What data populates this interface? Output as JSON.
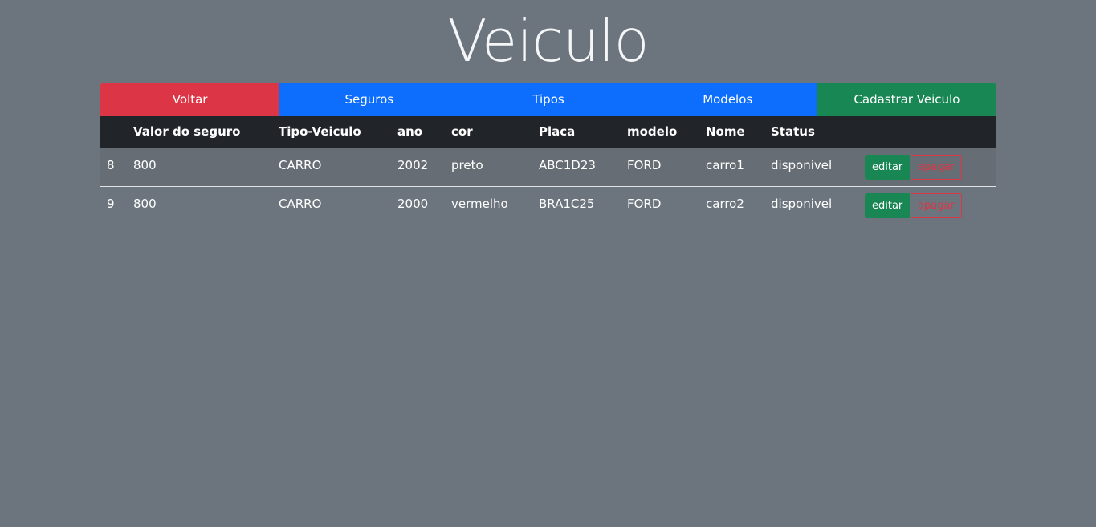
{
  "page": {
    "title": "Veiculo"
  },
  "nav": {
    "voltar": "Voltar",
    "seguros": "Seguros",
    "tipos": "Tipos",
    "modelos": "Modelos",
    "cadastrar": "Cadastrar Veiculo"
  },
  "colors": {
    "background": "#6c757d",
    "danger": "#dc3545",
    "primary": "#0d6efd",
    "success": "#198754",
    "table_header": "#212529"
  },
  "table": {
    "headers": {
      "id": "",
      "valor": "Valor do seguro",
      "tipo": "Tipo-Veiculo",
      "ano": "ano",
      "cor": "cor",
      "placa": "Placa",
      "modelo": "modelo",
      "nome": "Nome",
      "status": "Status",
      "acoes": ""
    },
    "rows": [
      {
        "id": "8",
        "valor": "800",
        "tipo": "CARRO",
        "ano": "2002",
        "cor": "preto",
        "placa": "ABC1D23",
        "modelo": "FORD",
        "nome": "carro1",
        "status": "disponivel",
        "edit_label": "editar",
        "delete_label": "apagar"
      },
      {
        "id": "9",
        "valor": "800",
        "tipo": "CARRO",
        "ano": "2000",
        "cor": "vermelho",
        "placa": "BRA1C25",
        "modelo": "FORD",
        "nome": "carro2",
        "status": "disponivel",
        "edit_label": "editar",
        "delete_label": "apagar"
      }
    ]
  }
}
